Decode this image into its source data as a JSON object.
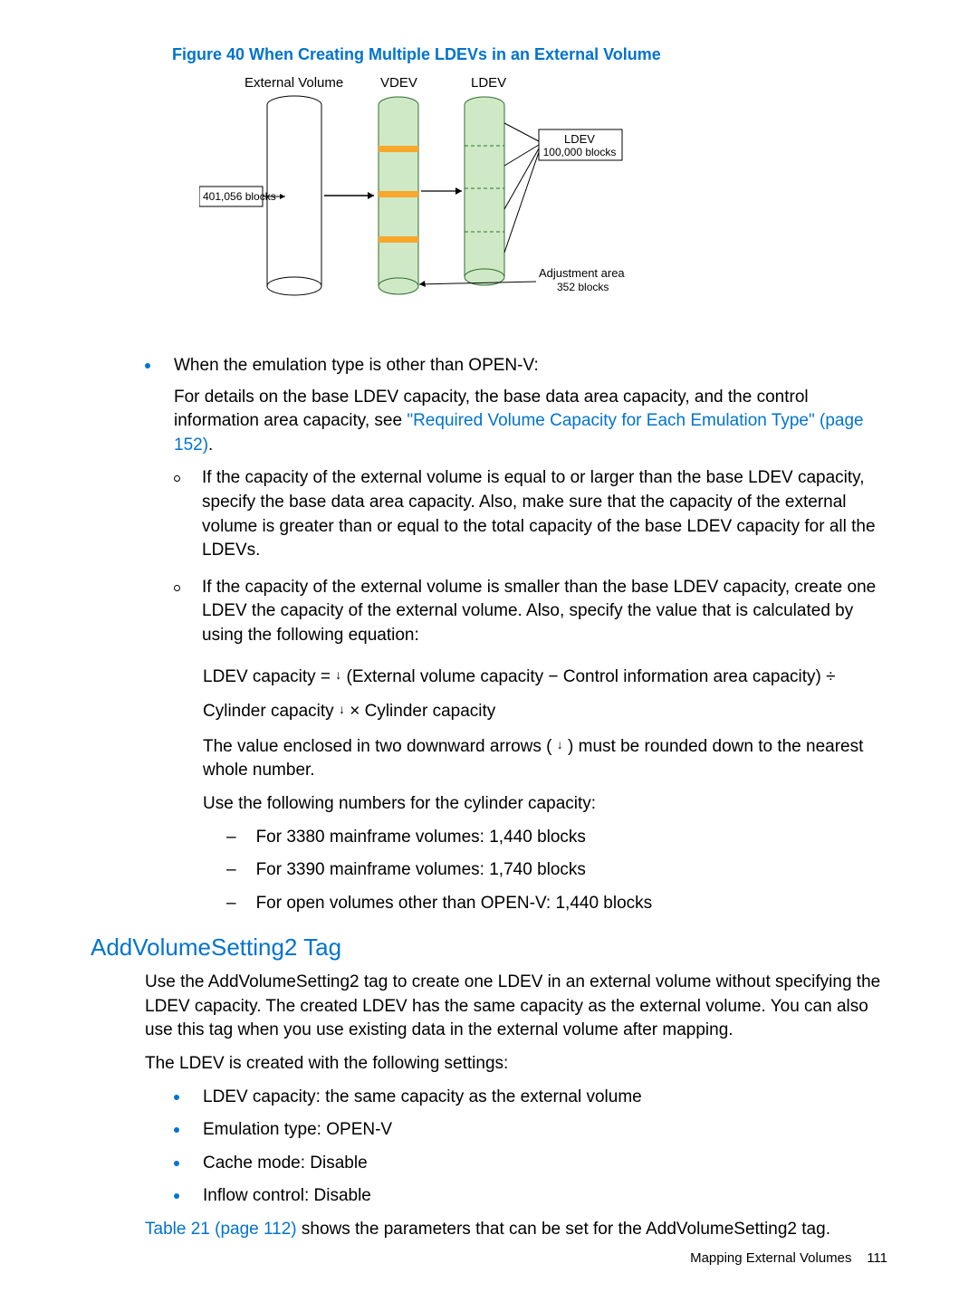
{
  "figure": {
    "caption": "Figure 40 When Creating Multiple LDEVs in an External Volume",
    "labels": {
      "external_volume": "External Volume",
      "vdev": "VDEV",
      "ldev": "LDEV",
      "blocks_left": "401,056 blocks",
      "ldev_box": "LDEV\n100,000 blocks",
      "adjustment": "Adjustment area\n352 blocks"
    }
  },
  "bullet1": {
    "line1": "When the emulation type is other than OPEN-V:",
    "para1a": "For details on the base LDEV capacity, the base data area capacity, and the control information area capacity, see ",
    "para1_link": "\"Required Volume Capacity for Each Emulation Type\" (page 152)",
    "para1b": ".",
    "sub1": "If the capacity of the external volume is equal to or larger than the base LDEV capacity, specify the base data area capacity. Also, make sure that the capacity of the external volume is greater than or equal to the total capacity of the base LDEV capacity for all the LDEVs.",
    "sub2": "If the capacity of the external volume is smaller than the base LDEV capacity, create one LDEV the capacity of the external volume. Also, specify the value that is calculated by using the following equation:",
    "eq_part1": "LDEV capacity = ",
    "eq_part2": " (External volume capacity − Control information area capacity) ÷",
    "eq_part3": "Cylinder capacity ",
    "eq_part4": " × Cylinder capacity",
    "sub2_note_a": "The value enclosed in two downward arrows ( ",
    "sub2_note_b": " ) must be rounded down to the nearest whole number.",
    "sub2_note2": "Use the following numbers for the cylinder capacity:",
    "dash1": "For 3380 mainframe volumes: 1,440 blocks",
    "dash2": "For 3390 mainframe volumes: 1,740 blocks",
    "dash3": "For open volumes other than OPEN-V: 1,440 blocks"
  },
  "section": {
    "title": "AddVolumeSetting2 Tag",
    "p1": "Use the AddVolumeSetting2 tag to create one LDEV in an external volume without specifying the LDEV capacity. The created LDEV has the same capacity as the external volume. You can also use this tag when you use existing data in the external volume after mapping.",
    "p2": "The LDEV is created with the following settings:",
    "items": [
      "LDEV capacity: the same capacity as the external volume",
      "Emulation type: OPEN-V",
      "Cache mode: Disable",
      "Inflow control: Disable"
    ],
    "p3_link": "Table 21 (page 112)",
    "p3_rest": " shows the parameters that can be set for the AddVolumeSetting2 tag."
  },
  "footer": {
    "text": "Mapping External Volumes",
    "page": "111"
  }
}
